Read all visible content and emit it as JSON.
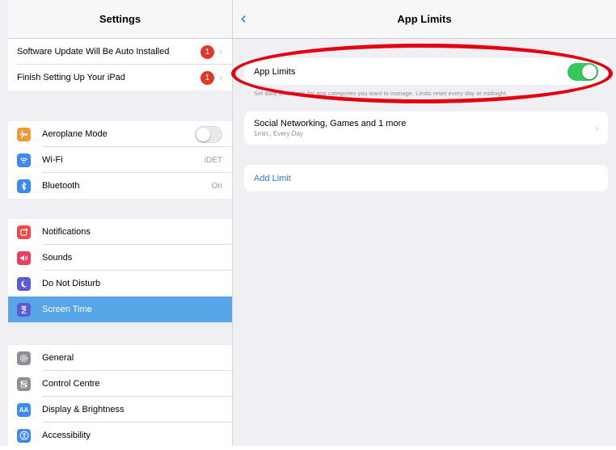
{
  "colors": {
    "accent": "#3478f6",
    "selected": "#58a6e8",
    "toggle_on": "#34c759",
    "badge": "#e0392b",
    "annotation": "#e3000f"
  },
  "master": {
    "title": "Settings",
    "notices": [
      {
        "label": "Software Update Will Be Auto Installed",
        "badge": "1",
        "icon": "chevron-right-icon"
      },
      {
        "label": "Finish Setting Up Your iPad",
        "badge": "1",
        "icon": "chevron-right-icon"
      }
    ],
    "connectivity": [
      {
        "label": "Aeroplane Mode",
        "icon": "airplane-icon",
        "icon_color": "#f09a37",
        "toggle": false
      },
      {
        "label": "Wi-Fi",
        "icon": "wifi-icon",
        "icon_color": "#3d8af7",
        "value": "iDET"
      },
      {
        "label": "Bluetooth",
        "icon": "bluetooth-icon",
        "icon_color": "#3d8af7",
        "value": "On"
      }
    ],
    "alerts": [
      {
        "label": "Notifications",
        "icon": "notifications-icon",
        "icon_color": "#ef4a45"
      },
      {
        "label": "Sounds",
        "icon": "sounds-icon",
        "icon_color": "#ef3d60"
      },
      {
        "label": "Do Not Disturb",
        "icon": "moon-icon",
        "icon_color": "#5b5bd6"
      },
      {
        "label": "Screen Time",
        "icon": "hourglass-icon",
        "icon_color": "#5b5bd6",
        "selected": true
      }
    ],
    "general": [
      {
        "label": "General",
        "icon": "gear-icon",
        "icon_color": "#8e8e93"
      },
      {
        "label": "Control Centre",
        "icon": "control-centre-icon",
        "icon_color": "#8e8e93"
      },
      {
        "label": "Display & Brightness",
        "icon": "display-icon",
        "icon_color": "#3d8af7",
        "glyph": "AA"
      },
      {
        "label": "Accessibility",
        "icon": "accessibility-icon",
        "icon_color": "#3d8af7"
      }
    ]
  },
  "detail": {
    "title": "App Limits",
    "back_icon": "chevron-left-icon",
    "app_limits_label": "App Limits",
    "app_limits_enabled": true,
    "footnote": "Set daily time limits for app categories you want to manage. Limits reset every day at midnight.",
    "limit": {
      "title": "Social Networking, Games and 1 more",
      "subtitle": "1min., Every Day"
    },
    "add_limit_label": "Add Limit"
  }
}
